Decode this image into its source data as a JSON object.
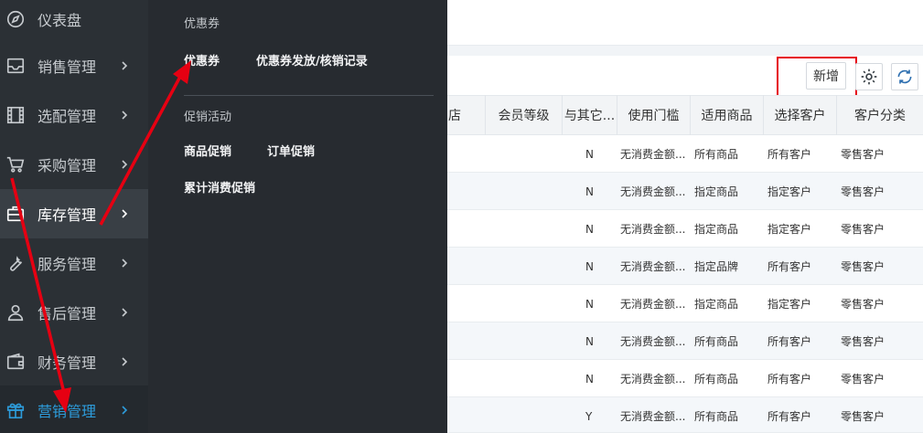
{
  "sidebar": {
    "items": [
      {
        "label": "仪表盘",
        "icon": "compass-icon",
        "chevron": false
      },
      {
        "label": "销售管理",
        "icon": "inbox-icon",
        "chevron": true
      },
      {
        "label": "选配管理",
        "icon": "film-icon",
        "chevron": true
      },
      {
        "label": "采购管理",
        "icon": "cart-icon",
        "chevron": true
      },
      {
        "label": "库存管理",
        "icon": "toolbox-icon",
        "chevron": true
      },
      {
        "label": "服务管理",
        "icon": "wrench-icon",
        "chevron": true
      },
      {
        "label": "售后管理",
        "icon": "user-icon",
        "chevron": true
      },
      {
        "label": "财务管理",
        "icon": "wallet-icon",
        "chevron": true
      },
      {
        "label": "营销管理",
        "icon": "gift-icon",
        "chevron": true
      }
    ]
  },
  "flyout": {
    "group1": "优惠券",
    "coupon": "优惠券",
    "coupon_records": "优惠券发放/核销记录",
    "group2": "促销活动",
    "product_promo": "商品促销",
    "order_promo": "订单促销",
    "cumulative_promo": "累计消费促销"
  },
  "toolbar": {
    "new_label": "新增",
    "settings_icon": "gear-icon",
    "refresh_icon": "refresh-icon"
  },
  "table": {
    "headers": [
      "店",
      "会员等级",
      "与其它...",
      "使用门槛",
      "适用商品",
      "选择客户",
      "客户分类"
    ],
    "rows": [
      [
        "N",
        "无消费金额...",
        "所有商品",
        "所有客户",
        "零售客户"
      ],
      [
        "N",
        "无消费金额...",
        "指定商品",
        "指定客户",
        "零售客户"
      ],
      [
        "N",
        "无消费金额...",
        "指定商品",
        "指定客户",
        "零售客户"
      ],
      [
        "N",
        "无消费金额...",
        "指定品牌",
        "所有客户",
        "零售客户"
      ],
      [
        "N",
        "无消费金额...",
        "指定商品",
        "指定客户",
        "零售客户"
      ],
      [
        "N",
        "无消费金额...",
        "所有商品",
        "所有客户",
        "零售客户"
      ],
      [
        "N",
        "无消费金额...",
        "所有商品",
        "所有客户",
        "零售客户"
      ],
      [
        "Y",
        "无消费金额...",
        "所有商品",
        "所有客户",
        "零售客户"
      ]
    ]
  },
  "colors": {
    "accent": "#2d9cdb",
    "annotation": "#e60012",
    "sidebar_bg": "#2b3035",
    "flyout_bg": "#272b30"
  }
}
